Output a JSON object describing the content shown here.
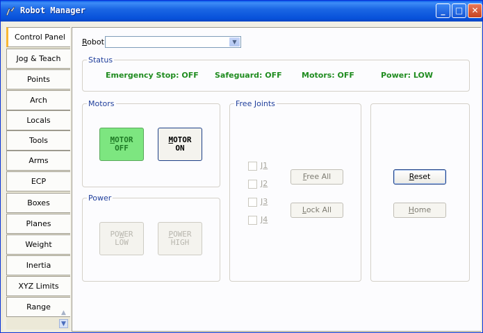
{
  "window": {
    "title": "Robot Manager",
    "controls": {
      "minimize": "_",
      "maximize": "□",
      "close": "✕"
    }
  },
  "tabs": [
    "Control Panel",
    "Jog & Teach",
    "Points",
    "Arch",
    "Locals",
    "Tools",
    "Arms",
    "ECP",
    "Boxes",
    "Planes",
    "Weight",
    "Inertia",
    "XYZ Limits",
    "Range"
  ],
  "active_tab": "Control Panel",
  "robot": {
    "label_u": "R",
    "label_rest": "obot:",
    "value": ""
  },
  "status": {
    "title": "Status",
    "emergency_stop": "Emergency Stop: OFF",
    "safeguard": "Safeguard: OFF",
    "motors": "Motors: OFF",
    "power": "Power: LOW"
  },
  "motors": {
    "title": "Motors",
    "off_line1_u": "M",
    "off_line1_rest": "OTOR",
    "off_line2": "OFF",
    "on_line1_u": "M",
    "on_line1_rest": "OTOR",
    "on_line2": "ON"
  },
  "power": {
    "title": "Power",
    "low_line1_pre": "PO",
    "low_line1_u": "W",
    "low_line1_rest": "ER",
    "low_line2": "LOW",
    "high_line1_u": "P",
    "high_line1_rest": "OWER",
    "high_line2": "HIGH"
  },
  "free_joints": {
    "title": "Free Joints",
    "joints": [
      {
        "pre": "J",
        "u": "1"
      },
      {
        "pre": "J",
        "u": "2"
      },
      {
        "pre": "J",
        "u": "3"
      },
      {
        "pre": "J",
        "u": "4"
      }
    ],
    "free_all_u": "F",
    "free_all_rest": "ree All",
    "lock_all_u": "L",
    "lock_all_rest": "ock All"
  },
  "actions": {
    "reset_u": "R",
    "reset_rest": "eset",
    "home_u": "H",
    "home_rest": "ome"
  }
}
